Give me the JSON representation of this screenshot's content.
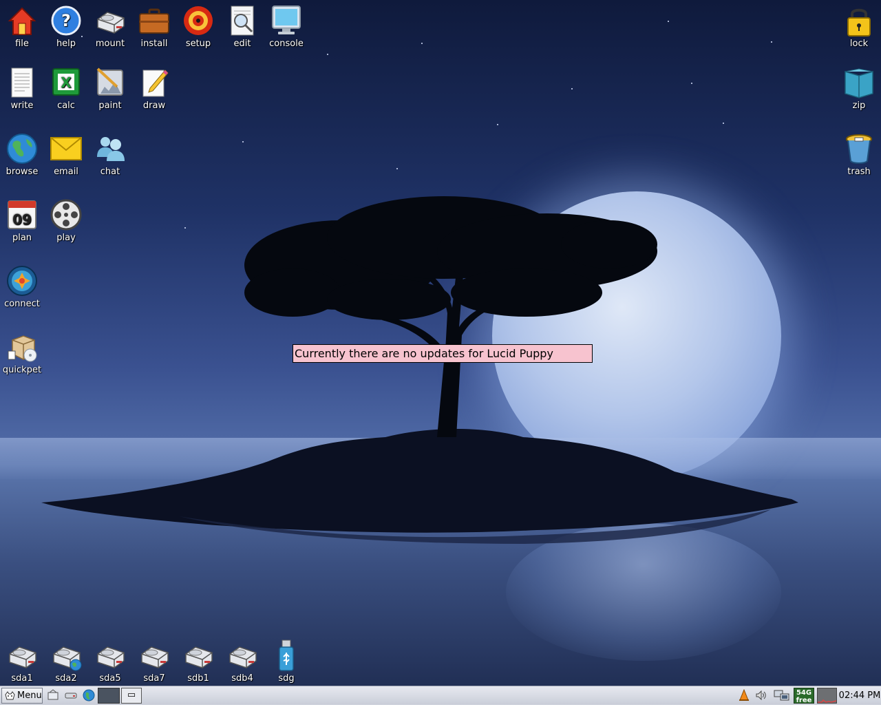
{
  "desktop": {
    "left_icons": [
      {
        "label": "file",
        "icon": "home-icon"
      },
      {
        "label": "help",
        "icon": "help-icon"
      },
      {
        "label": "mount",
        "icon": "drive-icon"
      },
      {
        "label": "install",
        "icon": "briefcase-icon"
      },
      {
        "label": "setup",
        "icon": "setup-target-icon"
      },
      {
        "label": "edit",
        "icon": "edit-document-icon"
      },
      {
        "label": "console",
        "icon": "monitor-icon"
      },
      {
        "label": "write",
        "icon": "document-icon"
      },
      {
        "label": "calc",
        "icon": "spreadsheet-icon"
      },
      {
        "label": "paint",
        "icon": "paint-icon"
      },
      {
        "label": "draw",
        "icon": "pencil-icon"
      },
      {
        "label": "browse",
        "icon": "globe-icon"
      },
      {
        "label": "email",
        "icon": "envelope-icon"
      },
      {
        "label": "chat",
        "icon": "people-icon"
      },
      {
        "label": "plan",
        "icon": "calendar-icon"
      },
      {
        "label": "play",
        "icon": "film-reel-icon"
      },
      {
        "label": "connect",
        "icon": "network-icon"
      },
      {
        "label": "quickpet",
        "icon": "package-icon"
      }
    ],
    "right_icons": [
      {
        "label": "lock",
        "icon": "padlock-icon"
      },
      {
        "label": "zip",
        "icon": "archive-icon"
      },
      {
        "label": "trash",
        "icon": "trash-icon"
      }
    ],
    "drive_icons": [
      {
        "label": "sda1"
      },
      {
        "label": "sda2"
      },
      {
        "label": "sda5"
      },
      {
        "label": "sda7"
      },
      {
        "label": "sdb1"
      },
      {
        "label": "sdb4"
      },
      {
        "label": "sdg"
      }
    ],
    "calendar_day": "09"
  },
  "notice": {
    "text": "Currently there are no updates for Lucid Puppy"
  },
  "taskbar": {
    "menu_label": "Menu",
    "minimize_glyph": "▭",
    "free_size": "54G",
    "free_label": "free",
    "clock": "02:44 PM"
  }
}
